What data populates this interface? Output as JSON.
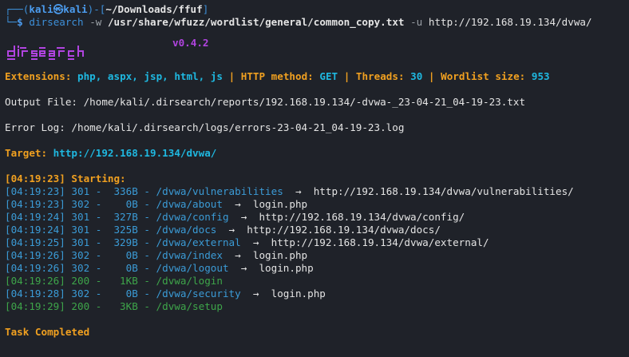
{
  "prompt": {
    "corner_top": "┌──(",
    "user": "kali",
    "at_symbol": "㉿",
    "host": "kali",
    "bracket_mid": ")-[",
    "path": "~/Downloads/ffuf",
    "bracket_end": "]",
    "corner_bottom": "└─",
    "dollar": "$",
    "command": "dirsearch",
    "arg_w": "-w",
    "wordlist": "/usr/share/wfuzz/wordlist/general/common_copy.txt",
    "arg_u": "-u",
    "url": "http://192.168.19.134/dvwa/"
  },
  "banner": {
    "logo_text": "dirsearch",
    "version": "v0.4.2"
  },
  "config": {
    "extensions_label": "Extensions:",
    "extensions_value": "php, aspx, jsp, html, js",
    "sep": "|",
    "method_label": "HTTP method:",
    "method_value": "GET",
    "threads_label": "Threads:",
    "threads_value": "30",
    "wordlist_label": "Wordlist size:",
    "wordlist_value": "953"
  },
  "output_file": "Output File: /home/kali/.dirsearch/reports/192.168.19.134/-dvwa-_23-04-21_04-19-23.txt",
  "error_log": "Error Log: /home/kali/.dirsearch/logs/errors-23-04-21_04-19-23.log",
  "target": {
    "label": "Target:",
    "url": "http://192.168.19.134/dvwa/"
  },
  "starting": "[04:19:23] Starting:",
  "results": [
    {
      "time": "[04:19:23]",
      "code": "301",
      "size": "336B",
      "path": "/dvwa/vulnerabilities",
      "redirect": "http://192.168.19.134/dvwa/vulnerabilities/",
      "color": "#3b9bd6"
    },
    {
      "time": "[04:19:23]",
      "code": "302",
      "size": "0B",
      "path": "/dvwa/about",
      "redirect": "login.php",
      "color": "#3b9bd6"
    },
    {
      "time": "[04:19:24]",
      "code": "301",
      "size": "327B",
      "path": "/dvwa/config",
      "redirect": "http://192.168.19.134/dvwa/config/",
      "color": "#3b9bd6"
    },
    {
      "time": "[04:19:24]",
      "code": "301",
      "size": "325B",
      "path": "/dvwa/docs",
      "redirect": "http://192.168.19.134/dvwa/docs/",
      "color": "#3b9bd6"
    },
    {
      "time": "[04:19:25]",
      "code": "301",
      "size": "329B",
      "path": "/dvwa/external",
      "redirect": "http://192.168.19.134/dvwa/external/",
      "color": "#3b9bd6"
    },
    {
      "time": "[04:19:26]",
      "code": "302",
      "size": "0B",
      "path": "/dvwa/index",
      "redirect": "login.php",
      "color": "#3b9bd6"
    },
    {
      "time": "[04:19:26]",
      "code": "302",
      "size": "0B",
      "path": "/dvwa/logout",
      "redirect": "login.php",
      "color": "#3b9bd6"
    },
    {
      "time": "[04:19:26]",
      "code": "200",
      "size": "1KB",
      "path": "/dvwa/login",
      "redirect": "",
      "color": "#3ea54a"
    },
    {
      "time": "[04:19:28]",
      "code": "302",
      "size": "0B",
      "path": "/dvwa/security",
      "redirect": "login.php",
      "color": "#3b9bd6"
    },
    {
      "time": "[04:19:29]",
      "code": "200",
      "size": "3KB",
      "path": "/dvwa/setup",
      "redirect": "",
      "color": "#3ea54a"
    }
  ],
  "arrow": "→",
  "task_completed": "Task Completed",
  "colors": {
    "background": "#1f2229",
    "orange": "#f0a020",
    "cyan": "#1fb8e0",
    "purple": "#b144e0",
    "redirect_status": "#3b9bd6",
    "ok_status": "#3ea54a"
  }
}
